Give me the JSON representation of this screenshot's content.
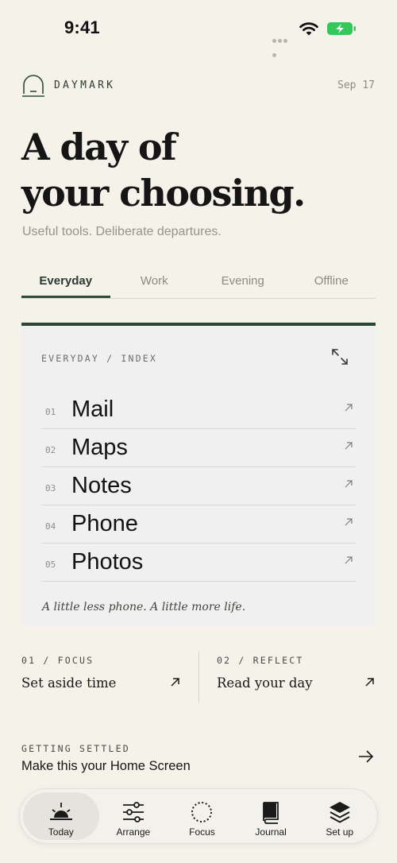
{
  "status_bar": {
    "time": "9:41"
  },
  "header": {
    "brand": "DAYMARK",
    "date": "Sep 17"
  },
  "hero": {
    "title_lines": [
      "A day of",
      "your choosing."
    ],
    "subtitle": "Useful tools. Deliberate departures."
  },
  "tabs": [
    {
      "label": "Everyday",
      "active": true
    },
    {
      "label": "Work",
      "active": false
    },
    {
      "label": "Evening",
      "active": false
    },
    {
      "label": "Offline",
      "active": false
    }
  ],
  "card": {
    "label": "EVERYDAY / INDEX",
    "apps": [
      {
        "num": "01",
        "name": "Mail"
      },
      {
        "num": "02",
        "name": "Maps"
      },
      {
        "num": "03",
        "name": "Notes"
      },
      {
        "num": "04",
        "name": "Phone"
      },
      {
        "num": "05",
        "name": "Photos"
      }
    ],
    "tagline": "A little less phone. A little more life."
  },
  "features": [
    {
      "label": "01 / FOCUS",
      "title": "Set aside time"
    },
    {
      "label": "02 / REFLECT",
      "title": "Read your day"
    }
  ],
  "settled": {
    "label": "GETTING SETTLED",
    "title": "Make this your Home Screen"
  },
  "nav": [
    {
      "label": "Today",
      "icon": "sunrise-icon",
      "active": true
    },
    {
      "label": "Arrange",
      "icon": "sliders-icon",
      "active": false
    },
    {
      "label": "Focus",
      "icon": "dotted-circle-icon",
      "active": false
    },
    {
      "label": "Journal",
      "icon": "book-icon",
      "active": false
    },
    {
      "label": "Set up",
      "icon": "layers-icon",
      "active": false
    }
  ],
  "colors": {
    "accent": "#2f4a36",
    "background": "#f5f2ea",
    "card": "#eff0ef",
    "battery": "#34c759"
  }
}
